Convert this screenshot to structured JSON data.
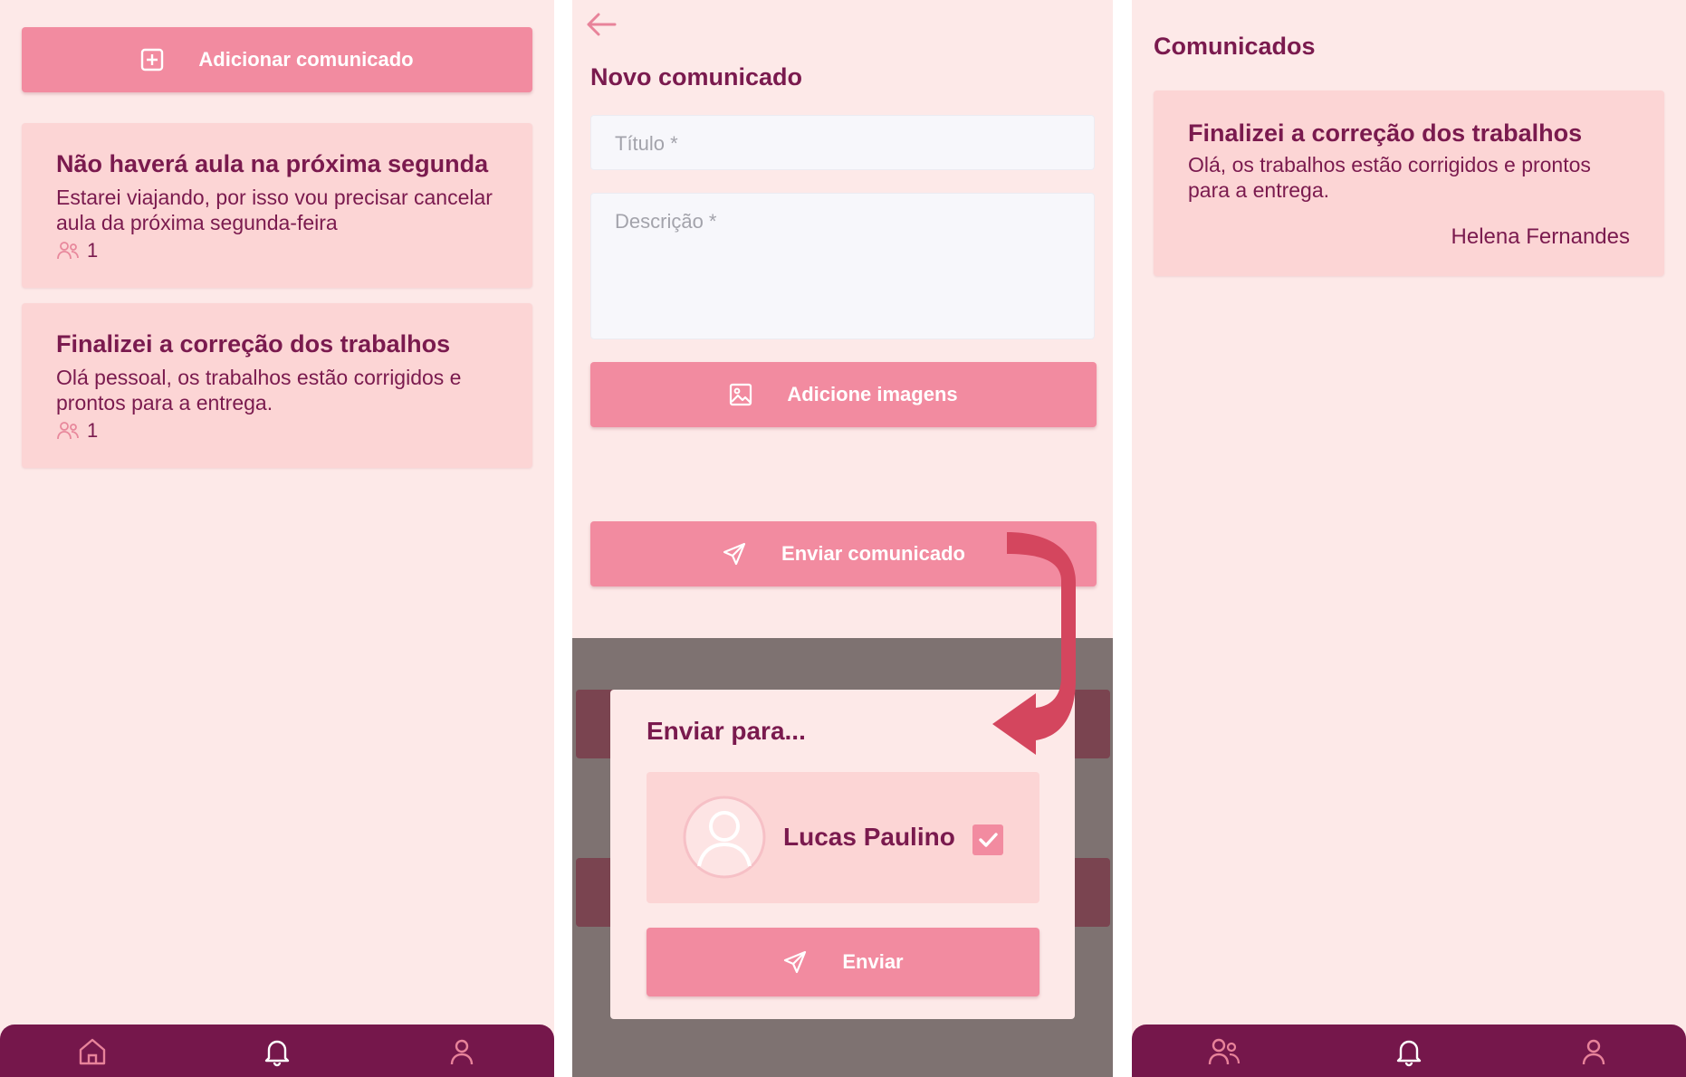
{
  "colors": {
    "background": "#fde9e8",
    "accent": "#f28ba0",
    "card": "#fcd5d5",
    "text": "#7a1a4e",
    "nav": "#75174b",
    "arrow": "#d4465e"
  },
  "list_screen": {
    "add_button": {
      "label": "Adicionar comunicado",
      "icon": "plus-square-icon"
    },
    "cards": [
      {
        "title": "Não haverá aula na próxima segunda",
        "description": "Estarei viajando, por isso vou precisar cancelar aula da próxima segunda-feira",
        "recipients_count": "1"
      },
      {
        "title": "Finalizei a correção dos trabalhos",
        "description": "Olá pessoal, os trabalhos estão corrigidos e prontos para a entrega.",
        "recipients_count": "1"
      }
    ],
    "nav": [
      "home-icon",
      "bell-icon",
      "user-icon"
    ]
  },
  "form_screen": {
    "back_icon": "arrow-left-icon",
    "title": "Novo comunicado",
    "title_placeholder": "Título *",
    "description_placeholder": "Descrição *",
    "add_images_label": "Adicione imagens",
    "send_label": "Enviar comunicado",
    "modal": {
      "title": "Enviar para...",
      "recipient_name": "Lucas Paulino",
      "recipient_checked": true,
      "send_button": "Enviar"
    }
  },
  "student_screen": {
    "header": "Comunicados",
    "card": {
      "title": "Finalizei a correção dos trabalhos",
      "description": "Olá, os trabalhos estão corrigidos e prontos para a entrega.",
      "author": "Helena Fernandes"
    },
    "nav": [
      "users-icon",
      "bell-icon",
      "user-icon"
    ]
  }
}
